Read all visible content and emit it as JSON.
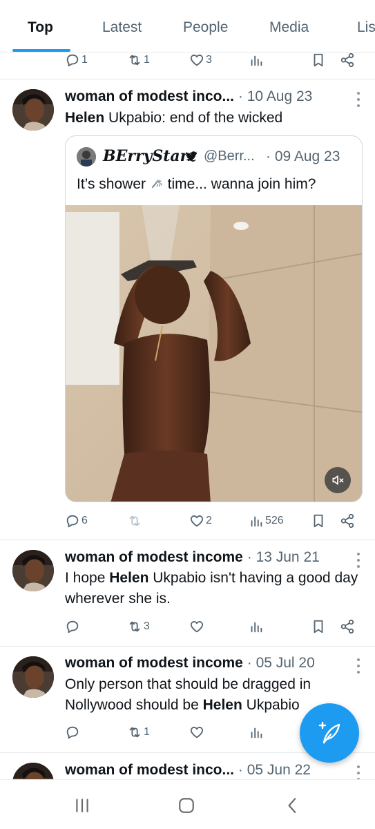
{
  "tabs": [
    {
      "label": "Top",
      "active": true
    },
    {
      "label": "Latest"
    },
    {
      "label": "People"
    },
    {
      "label": "Media"
    },
    {
      "label": "Lis"
    }
  ],
  "top_actions": {
    "replies": "1",
    "reposts": "1",
    "likes": "3"
  },
  "tweets": [
    {
      "name": "woman of modest inco...",
      "sep": "·",
      "date": "10 Aug 23",
      "text_bold": "Helen",
      "text_rest": " Ukpabio: end of the wicked",
      "quote": {
        "name": "BErryStarz",
        "handle": "@Berr...",
        "date": "· 09 Aug 23",
        "text_before": "It’s shower ",
        "text_after": " time... wanna join him?"
      },
      "actions": {
        "replies": "6",
        "reposts": "",
        "likes": "2",
        "views": "526"
      }
    },
    {
      "name": "woman of modest income",
      "sep": "·",
      "date": "13 Jun 21",
      "text_pre": "I hope ",
      "text_bold": "Helen",
      "text_post": " Ukpabio isn't having a good day wherever she is.",
      "actions": {
        "replies": "",
        "reposts": "3",
        "likes": "",
        "views": ""
      }
    },
    {
      "name": "woman of modest income",
      "sep": "·",
      "date": "05 Jul 20",
      "text_pre": "Only person that should be dragged in Nollywood should be ",
      "text_bold": "Helen",
      "text_post": " Ukpabio",
      "actions": {
        "replies": "",
        "reposts": "1",
        "likes": "",
        "views": ""
      }
    },
    {
      "name": "woman of modest inco...",
      "sep": "·",
      "date": "05 Jun 22"
    }
  ],
  "colors": {
    "accent": "#1d9bf0",
    "secondary_text": "#536471",
    "divider": "#e6e9ec"
  }
}
